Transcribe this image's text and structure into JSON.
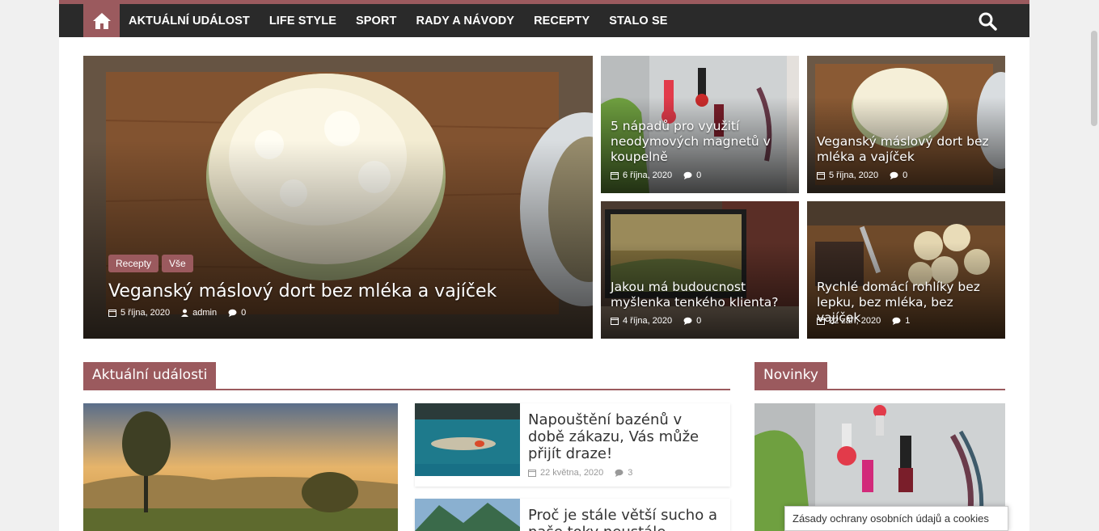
{
  "nav": {
    "home_icon": "home-icon",
    "items": [
      "AKTUÁLNÍ UDÁLOST",
      "LIFE STYLE",
      "SPORT",
      "RADY A NÁVODY",
      "RECEPTY",
      "STALO SE"
    ],
    "search_icon": "search-icon"
  },
  "hero": {
    "tags": [
      "Recepty",
      "Vše"
    ],
    "title": "Veganský máslový dort bez mléka a vajíček",
    "date": "5 října, 2020",
    "author": "admin",
    "comments": "0"
  },
  "tiles": [
    {
      "title": "5 nápadů pro využití neodymových magnetů v koupelně",
      "date": "6 října, 2020",
      "comments": "0"
    },
    {
      "title": "Veganský máslový dort bez mléka a vajíček",
      "date": "5 října, 2020",
      "comments": "0"
    },
    {
      "title": "Jakou má budoucnost myšlenka tenkého klienta?",
      "date": "4 října, 2020",
      "comments": "0"
    },
    {
      "title": "Rychlé domácí rohlíky bez lepku, bez mléka, bez vajíček",
      "date": "22 září, 2020",
      "comments": "1"
    }
  ],
  "sections": {
    "news": "Aktuální události",
    "sidebar": "Novinky"
  },
  "list": [
    {
      "title": "Napouštění bazénů v době zákazu, Vás může přijít draze!",
      "date": "22 května, 2020",
      "comments": "3"
    },
    {
      "title": "Proč je stále větší sucho a naše toky neustále",
      "date": "",
      "comments": ""
    }
  ],
  "cookie_text": "Zásady ochrany osobních údajů a cookies",
  "colors": {
    "accent": "#9b5a5e",
    "nav_bg": "#2a2a2a"
  }
}
